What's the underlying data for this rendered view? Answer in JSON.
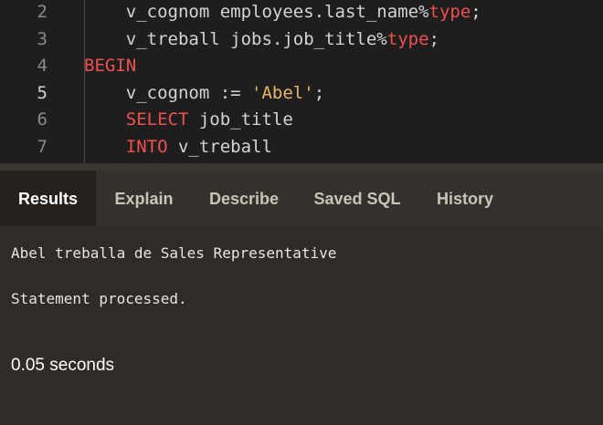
{
  "editor": {
    "lines": [
      {
        "num": "2",
        "indent": "    ",
        "parts": [
          {
            "t": "v_cognom employees.last_name%",
            "c": "plain"
          },
          {
            "t": "type",
            "c": "kw"
          },
          {
            "t": ";",
            "c": "plain"
          }
        ]
      },
      {
        "num": "3",
        "indent": "    ",
        "parts": [
          {
            "t": "v_treball jobs.job_title%",
            "c": "plain"
          },
          {
            "t": "type",
            "c": "kw"
          },
          {
            "t": ";",
            "c": "plain"
          }
        ]
      },
      {
        "num": "4",
        "indent": "",
        "parts": [
          {
            "t": "BEGIN",
            "c": "kw"
          }
        ]
      },
      {
        "num": "5",
        "indent": "    ",
        "parts": [
          {
            "t": "v_cognom := ",
            "c": "plain"
          },
          {
            "t": "'Abel'",
            "c": "str"
          },
          {
            "t": ";",
            "c": "plain"
          }
        ]
      },
      {
        "num": "6",
        "indent": "    ",
        "parts": [
          {
            "t": "SELECT",
            "c": "kw"
          },
          {
            "t": " job_title",
            "c": "plain"
          }
        ]
      },
      {
        "num": "7",
        "indent": "    ",
        "parts": [
          {
            "t": "INTO",
            "c": "kw"
          },
          {
            "t": " v_treball",
            "c": "plain"
          }
        ]
      }
    ],
    "active_line": "5"
  },
  "tabs": [
    {
      "label": "Results",
      "active": true
    },
    {
      "label": "Explain",
      "active": false
    },
    {
      "label": "Describe",
      "active": false
    },
    {
      "label": "Saved SQL",
      "active": false
    },
    {
      "label": "History",
      "active": false
    }
  ],
  "output": {
    "message": "Abel treballa de Sales Representative",
    "status": "Statement processed.",
    "timing": "0.05 seconds"
  },
  "colors": {
    "keyword": "#f0504f",
    "string": "#e8b46b",
    "plain": "#d4d4d4"
  }
}
